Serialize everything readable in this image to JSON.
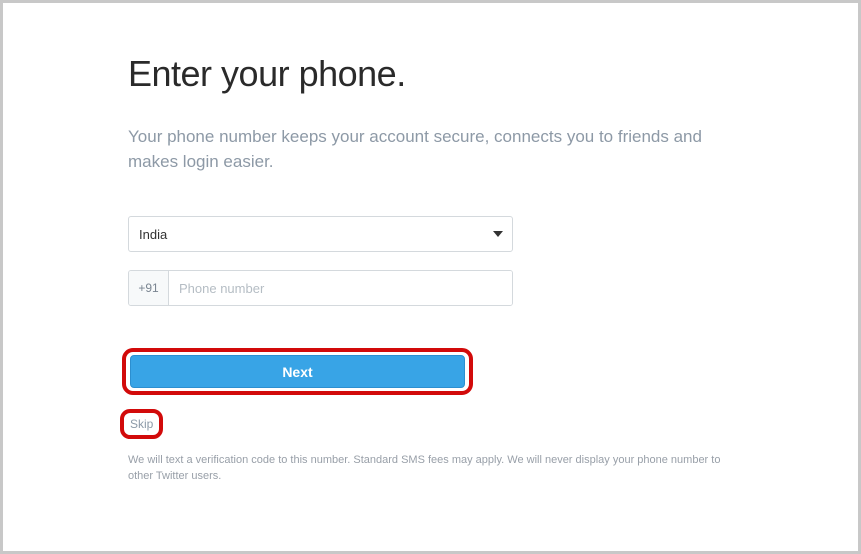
{
  "header": {
    "title": "Enter your phone.",
    "subtitle": "Your phone number keeps your account secure, connects you to friends and makes login easier."
  },
  "form": {
    "country_selected": "India",
    "phone_prefix": "+91",
    "phone_placeholder": "Phone number",
    "phone_value": ""
  },
  "actions": {
    "next_label": "Next",
    "skip_label": "Skip"
  },
  "footer": {
    "disclaimer": "We will text a verification code to this number. Standard SMS fees may apply. We will never display your phone number to other Twitter users."
  }
}
